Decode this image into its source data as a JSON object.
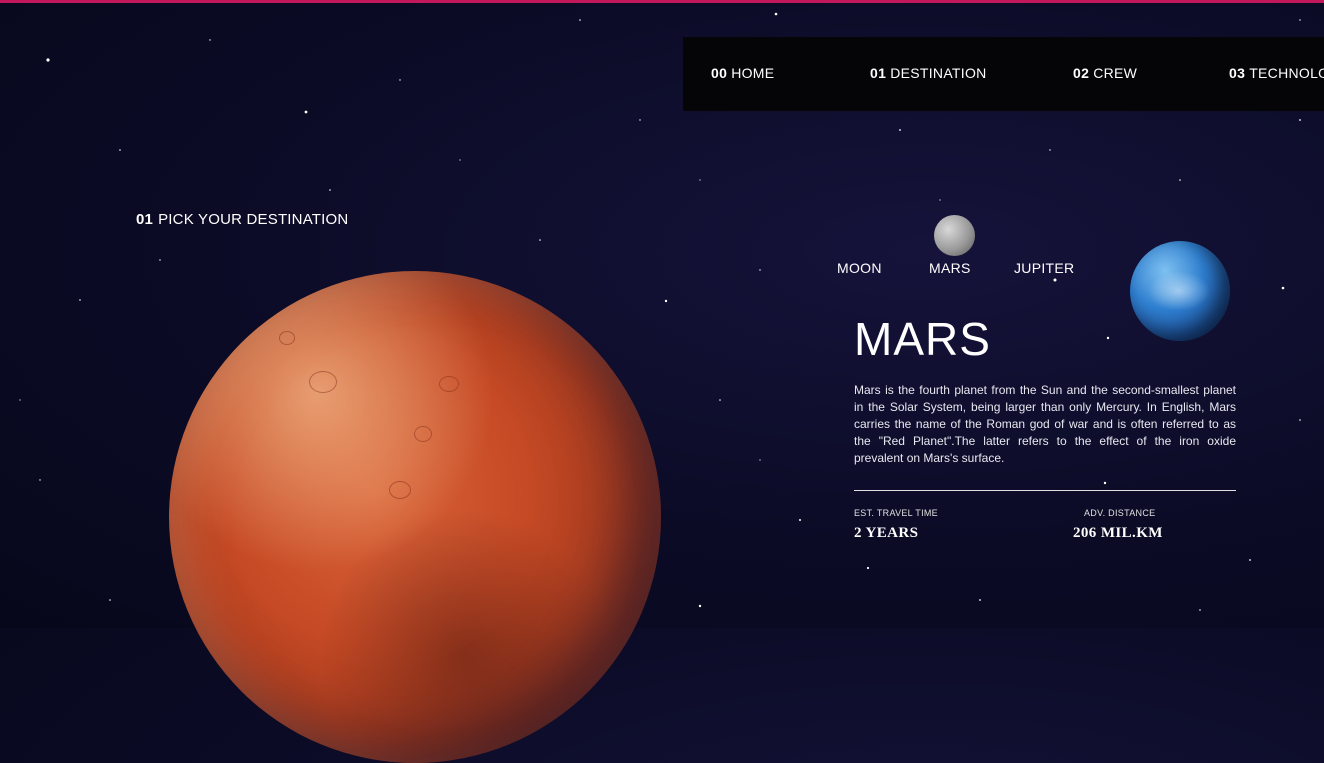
{
  "nav": {
    "items": [
      {
        "num": "00",
        "label": "HOME"
      },
      {
        "num": "01",
        "label": "DESTINATION"
      },
      {
        "num": "02",
        "label": "CREW"
      },
      {
        "num": "03",
        "label": "TECHNOLOGY"
      }
    ]
  },
  "heading": {
    "num": "01",
    "label": "PICK YOUR DESTINATION"
  },
  "tabs": [
    "MOON",
    "MARS",
    "JUPITER"
  ],
  "destination": {
    "name": "MARS",
    "description": "Mars is the fourth planet from the Sun and the second-smallest planet in the Solar System, being larger than only Mercury. In English, Mars carries the name of the Roman god of war and is often referred to as the \"Red Planet\".The latter refers to the effect of the iron oxide prevalent on Mars's surface.",
    "travel_label": "EST. TRAVEL TIME",
    "travel_value": "2 YEARS",
    "distance_label": "ADV. DISTANCE",
    "distance_value": "206 MIL.KM"
  },
  "colors": {
    "accent_line": "#c2185b",
    "background": "#0b0b26",
    "nav_bg": "#050508"
  }
}
